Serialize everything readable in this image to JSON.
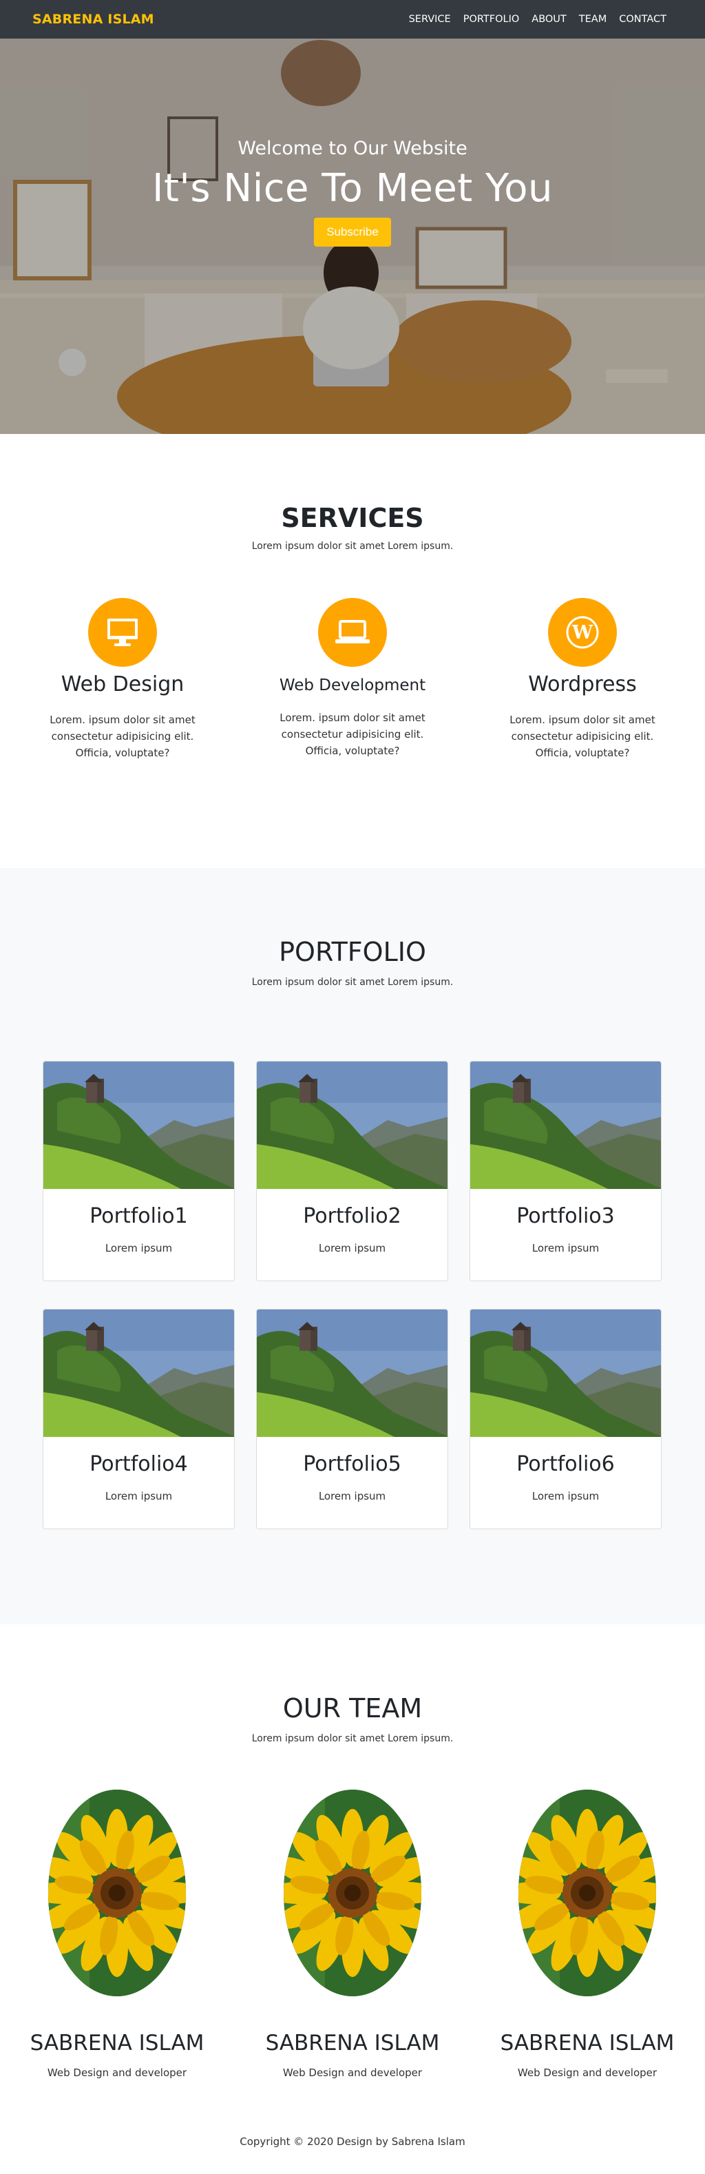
{
  "nav": {
    "brand": "SABRENA ISLAM",
    "links": [
      "SERVICE",
      "PORTFOLIO",
      "ABOUT",
      "TEAM",
      "CONTACT"
    ]
  },
  "hero": {
    "subtitle": "Welcome to Our Website",
    "title": "It's Nice To Meet You",
    "button": "Subscribe"
  },
  "services": {
    "title": "SERVICES",
    "subtitle": "Lorem ipsum dolor sit amet Lorem ipsum.",
    "items": [
      {
        "icon": "desktop-icon",
        "title": "Web Design",
        "text": "Lorem. ipsum dolor sit amet consectetur adipisicing elit. Officia, voluptate?"
      },
      {
        "icon": "laptop-icon",
        "title": "Web Development",
        "text": "Lorem. ipsum dolor sit amet consectetur adipisicing elit. Officia, voluptate?"
      },
      {
        "icon": "wordpress-icon",
        "title": "Wordpress",
        "text": "Lorem. ipsum dolor sit amet consectetur adipisicing elit. Officia, voluptate?"
      }
    ]
  },
  "portfolio": {
    "title": "PORTFOLIO",
    "subtitle": "Lorem ipsum dolor sit amet Lorem ipsum.",
    "items": [
      {
        "title": "Portfolio1",
        "text": "Lorem ipsum"
      },
      {
        "title": "Portfolio2",
        "text": "Lorem ipsum"
      },
      {
        "title": "Portfolio3",
        "text": "Lorem ipsum"
      },
      {
        "title": "Portfolio4",
        "text": "Lorem ipsum"
      },
      {
        "title": "Portfolio5",
        "text": "Lorem ipsum"
      },
      {
        "title": "Portfolio6",
        "text": "Lorem ipsum"
      }
    ]
  },
  "team": {
    "title": "OUR TEAM",
    "subtitle": "Lorem ipsum dolor sit amet Lorem ipsum.",
    "members": [
      {
        "name": "SABRENA ISLAM",
        "role": "Web Design and developer"
      },
      {
        "name": "SABRENA ISLAM",
        "role": "Web Design and developer"
      },
      {
        "name": "SABRENA ISLAM",
        "role": "Web Design and developer"
      }
    ]
  },
  "footer": {
    "text": "Copyright © 2020 Design by Sabrena Islam"
  },
  "colors": {
    "accent": "#ffc107",
    "icon_bg": "#ffa500",
    "navbar": "#343a40",
    "section_alt": "#f8f9fa"
  }
}
